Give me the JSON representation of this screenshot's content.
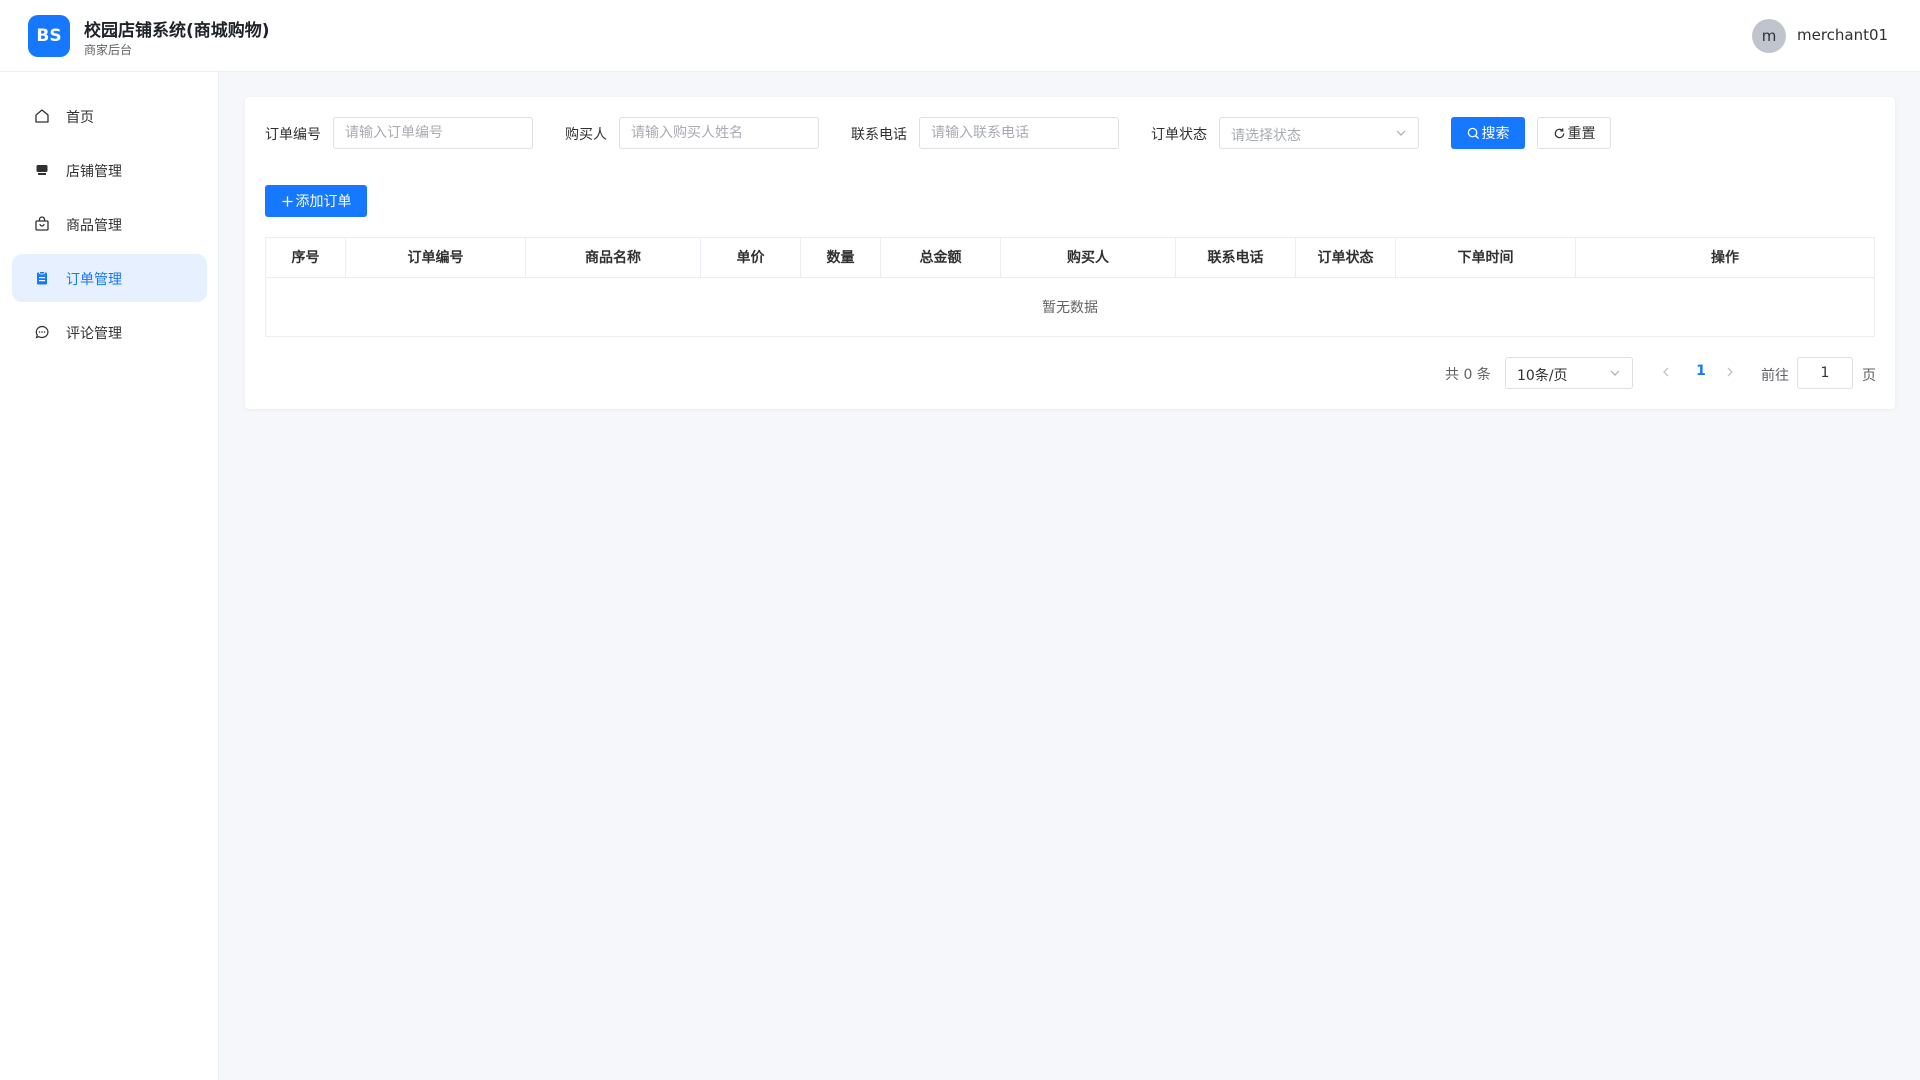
{
  "header": {
    "logo_text": "BS",
    "title": "校园店铺系统(商城购物)",
    "subtitle": "商家后台",
    "avatar_initial": "m",
    "username": "merchant01"
  },
  "sidebar": {
    "items": [
      {
        "label": "首页",
        "icon": "home-icon",
        "active": false
      },
      {
        "label": "店铺管理",
        "icon": "store-icon",
        "active": false
      },
      {
        "label": "商品管理",
        "icon": "shopping-bag-icon",
        "active": false
      },
      {
        "label": "订单管理",
        "icon": "clipboard-icon",
        "active": true
      },
      {
        "label": "评论管理",
        "icon": "comment-icon",
        "active": false
      }
    ]
  },
  "filters": {
    "order_no": {
      "label": "订单编号",
      "placeholder": "请输入订单编号",
      "value": ""
    },
    "buyer": {
      "label": "购买人",
      "placeholder": "请输入购买人姓名",
      "value": ""
    },
    "phone": {
      "label": "联系电话",
      "placeholder": "请输入联系电话",
      "value": ""
    },
    "status": {
      "label": "订单状态",
      "placeholder": "请选择状态"
    },
    "search_label": "搜索",
    "reset_label": "重置"
  },
  "toolbar": {
    "add_label": "添加订单"
  },
  "table": {
    "columns": [
      "序号",
      "订单编号",
      "商品名称",
      "单价",
      "数量",
      "总金额",
      "购买人",
      "联系电话",
      "订单状态",
      "下单时间",
      "操作"
    ],
    "rows": [],
    "empty_text": "暂无数据"
  },
  "pagination": {
    "total_text": "共 0 条",
    "page_size": "10条/页",
    "current_page": "1",
    "goto_label": "前往",
    "goto_value": "1",
    "page_suffix": "页"
  },
  "colors": {
    "primary": "#1677ff",
    "active_bg": "#e6f0ff",
    "page_bg": "#f5f7fa"
  }
}
